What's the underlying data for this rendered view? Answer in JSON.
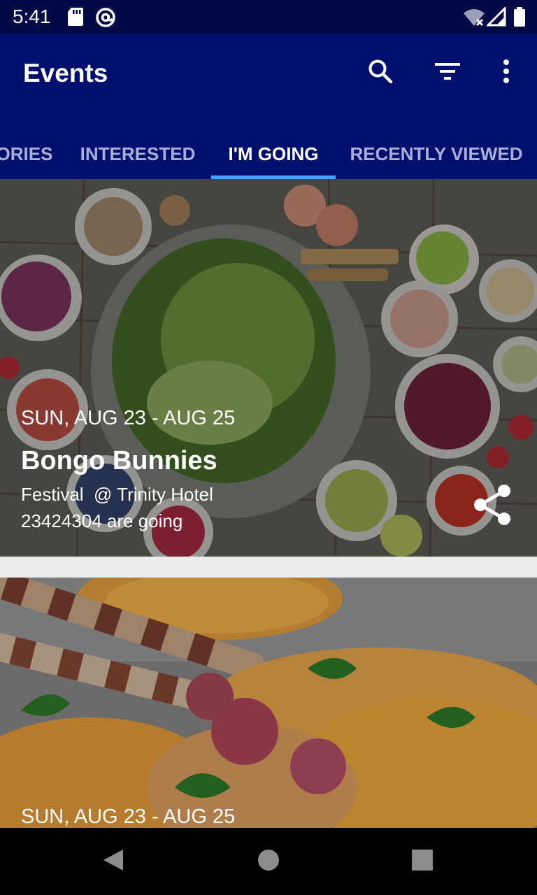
{
  "status_bar": {
    "time": "5:41"
  },
  "app_bar": {
    "title": "Events"
  },
  "tabs": [
    {
      "label": "ORIES",
      "active": false
    },
    {
      "label": "INTERESTED",
      "active": false
    },
    {
      "label": "I'M GOING",
      "active": true
    },
    {
      "label": "RECENTLY VIEWED",
      "active": false
    }
  ],
  "events": [
    {
      "date": "SUN, AUG 23 - AUG 25",
      "title": "Bongo Bunnies",
      "venue": "Festival  @ Trinity Hotel",
      "going": "23424304 are going"
    },
    {
      "date": "SUN, AUG 23 - AUG 25"
    }
  ],
  "icons": {
    "status": [
      "sd-card-icon",
      "at-sign-icon",
      "wifi-off-icon",
      "signal-icon",
      "battery-icon"
    ],
    "actions": [
      "search-icon",
      "filter-icon",
      "more-vert-icon"
    ],
    "card": [
      "share-icon"
    ],
    "nav": [
      "back-icon",
      "home-icon",
      "recents-icon"
    ]
  },
  "colors": {
    "status_bar": "#000a45",
    "app_bar": "#000e6e",
    "tab_indicator": "#4aa0ff",
    "tab_inactive": "#a8b0d8"
  }
}
